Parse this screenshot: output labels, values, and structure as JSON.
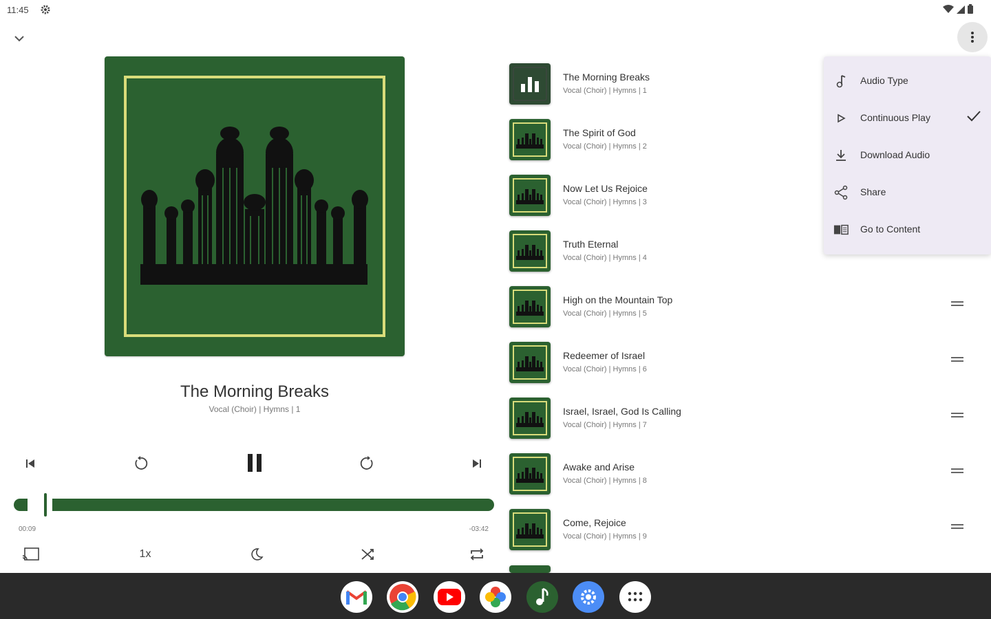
{
  "status_bar": {
    "time": "11:45"
  },
  "now_playing": {
    "title": "The Morning Breaks",
    "subtitle": "Vocal (Choir) | Hymns | 1",
    "elapsed": "00:09",
    "remaining": "-03:42",
    "progress_fraction": 0.04,
    "speed_label": "1x"
  },
  "queue": [
    {
      "title": "The Morning Breaks",
      "subtitle": "Vocal (Choir) | Hymns | 1",
      "playing": true
    },
    {
      "title": "The Spirit of God",
      "subtitle": "Vocal (Choir) | Hymns | 2"
    },
    {
      "title": "Now Let Us Rejoice",
      "subtitle": "Vocal (Choir) | Hymns | 3"
    },
    {
      "title": "Truth Eternal",
      "subtitle": "Vocal (Choir) | Hymns | 4"
    },
    {
      "title": "High on the Mountain Top",
      "subtitle": "Vocal (Choir) | Hymns | 5"
    },
    {
      "title": "Redeemer of Israel",
      "subtitle": "Vocal (Choir) | Hymns | 6"
    },
    {
      "title": "Israel, Israel, God Is Calling",
      "subtitle": "Vocal (Choir) | Hymns | 7"
    },
    {
      "title": "Awake and Arise",
      "subtitle": "Vocal (Choir) | Hymns | 8"
    },
    {
      "title": "Come, Rejoice",
      "subtitle": "Vocal (Choir) | Hymns | 9"
    }
  ],
  "menu": {
    "items": [
      {
        "label": "Audio Type",
        "icon": "music-note-icon"
      },
      {
        "label": "Continuous Play",
        "icon": "play-outline-icon",
        "checked": true
      },
      {
        "label": "Download Audio",
        "icon": "download-icon"
      },
      {
        "label": "Share",
        "icon": "share-icon"
      },
      {
        "label": "Go to Content",
        "icon": "book-icon"
      }
    ]
  },
  "dock": {
    "apps": [
      "gmail-icon",
      "chrome-icon",
      "youtube-icon",
      "photos-icon",
      "music-app-icon",
      "settings-icon",
      "app-drawer-icon"
    ]
  },
  "colors": {
    "accent": "#2b6130",
    "frame": "#d9dc7a",
    "menu_bg": "#eeeaf4",
    "dock_bg": "#2a2a2a"
  }
}
